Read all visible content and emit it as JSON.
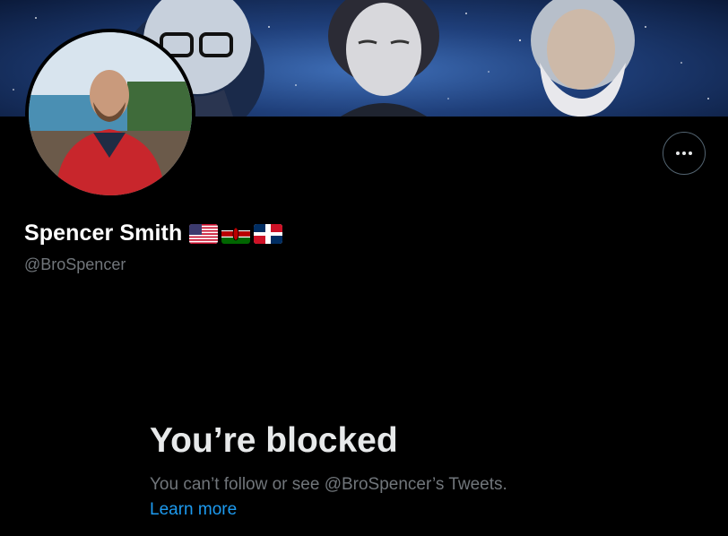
{
  "profile": {
    "display_name": "Spencer Smith",
    "handle": "@BroSpencer",
    "flags": [
      "us-flag-icon",
      "kenya-flag-icon",
      "dominican-republic-flag-icon"
    ]
  },
  "actions": {
    "more_icon": "more-horizontal-icon"
  },
  "blocked": {
    "title": "You’re blocked",
    "message": "You can’t follow or see @BroSpencer’s Tweets.",
    "link": "Learn more"
  },
  "colors": {
    "background": "#000000",
    "text_primary": "#e7e9ea",
    "text_secondary": "#71767b",
    "link": "#1d9bf0",
    "button_border": "#536471"
  }
}
